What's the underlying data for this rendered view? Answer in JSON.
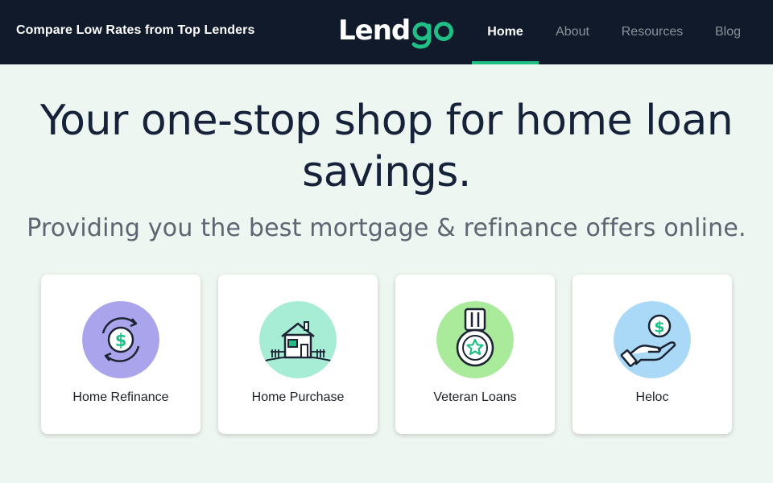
{
  "header": {
    "tagline": "Compare Low Rates from Top Lenders",
    "logo": {
      "part1": "Lend",
      "part2": "go"
    },
    "nav": [
      {
        "label": "Home",
        "active": true
      },
      {
        "label": "About",
        "active": false
      },
      {
        "label": "Resources",
        "active": false
      },
      {
        "label": "Blog",
        "active": false
      }
    ],
    "accent_color": "#1fbf86"
  },
  "hero": {
    "title": "Your one-stop shop for home loan savings.",
    "subtitle": "Providing you the best mortgage & refinance offers online."
  },
  "cards": [
    {
      "label": "Home Refinance",
      "icon": "refinance-dollar-cycle-icon",
      "icon_bg": "#a9a4ec"
    },
    {
      "label": "Home Purchase",
      "icon": "house-icon",
      "icon_bg": "#a7ecd5"
    },
    {
      "label": "Veteran Loans",
      "icon": "medal-star-icon",
      "icon_bg": "#a9ea9b"
    },
    {
      "label": "Heloc",
      "icon": "hand-dollar-coin-icon",
      "icon_bg": "#a9d9f7"
    }
  ]
}
